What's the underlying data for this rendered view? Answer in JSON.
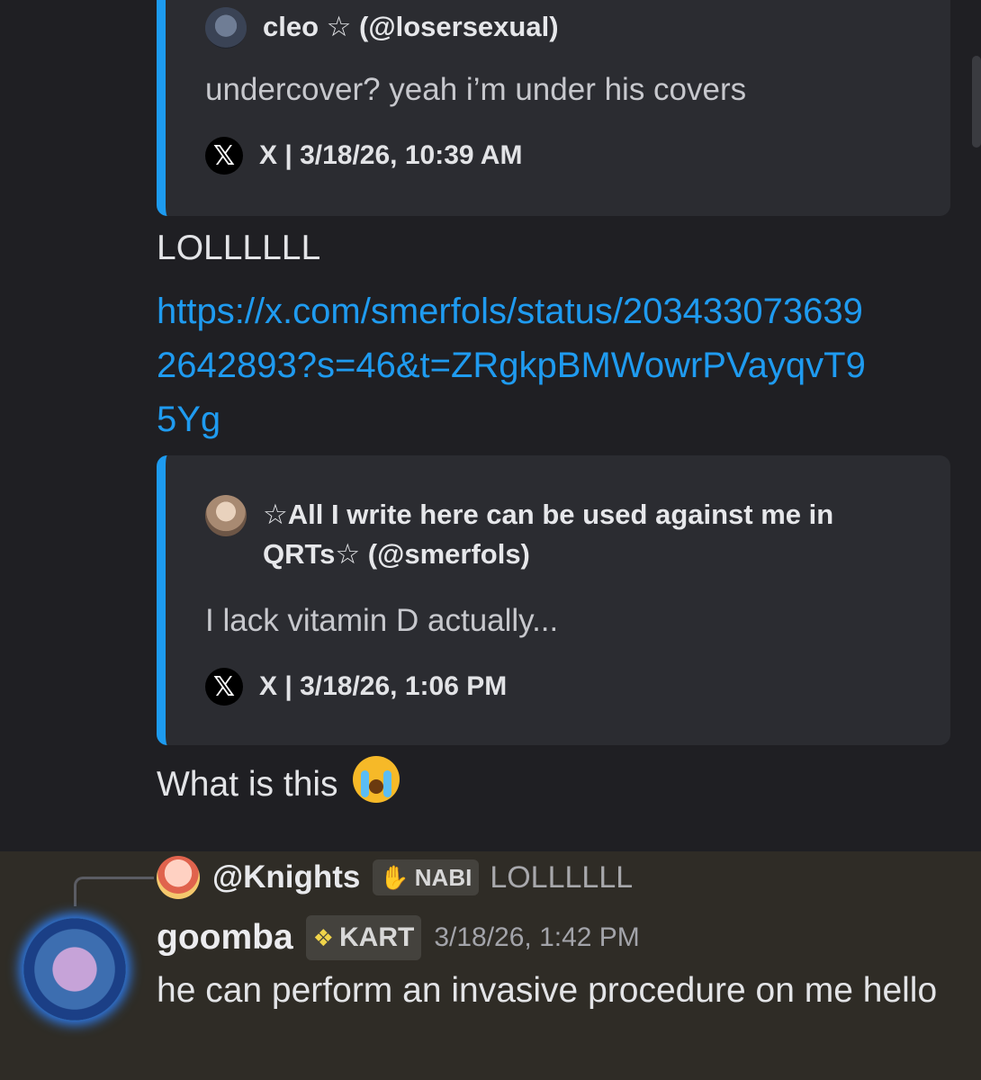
{
  "embed1": {
    "author": "cleo ☆ (@losersexual)",
    "text": "undercover? yeah i’m under his covers",
    "footer": "X | 3/18/26, 10:39 AM",
    "x_glyph": "𝕏"
  },
  "msg1": {
    "text": "LOLLLLLL"
  },
  "link": {
    "url": "https://x.com/smerfols/status/2034330736392642893?s=46&t=ZRgkpBMWowrPVayqvT95Yg"
  },
  "embed2": {
    "author_line1": "☆All I write here can be used against me in",
    "author_line2": "QRTs☆ (@smerfols)",
    "text": "I lack vitamin D actually...",
    "footer": "X | 3/18/26, 1:06 PM",
    "x_glyph": "𝕏"
  },
  "msg2": {
    "text": "What is this"
  },
  "reply": {
    "name": "@Knights",
    "tag_label": "NABI",
    "preview": "LOLLLLLL"
  },
  "message": {
    "username": "goomba",
    "tag_label": "KART",
    "timestamp": "3/18/26, 1:42 PM",
    "body": "he can perform an invasive procedure on me hello"
  },
  "colors": {
    "background": "#1f1f23",
    "embed_bg": "#2b2c31",
    "embed_border": "#1d9bf0",
    "link": "#1f9bf0",
    "highlight": "#2f2c26"
  },
  "icons": [
    "x-logo-icon",
    "loudly-crying-face-icon",
    "nabi-tag-icon",
    "kart-tag-icon"
  ]
}
